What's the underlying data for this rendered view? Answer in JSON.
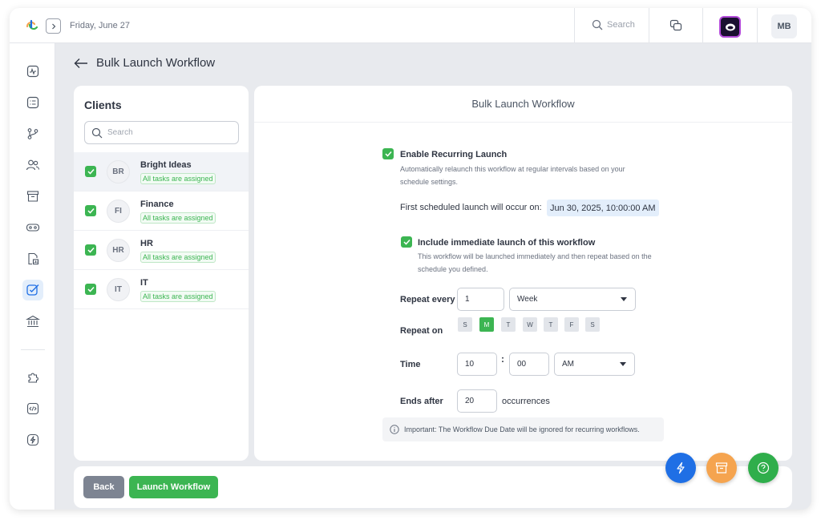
{
  "topbar": {
    "date": "Friday, June 27",
    "search_label": "Search",
    "avatar_initials": "MB"
  },
  "page": {
    "title": "Bulk Launch Workflow"
  },
  "clients": {
    "title": "Clients",
    "search_placeholder": "Search",
    "items": [
      {
        "initials": "BR",
        "name": "Bright Ideas",
        "status": "All tasks are assigned",
        "checked": true
      },
      {
        "initials": "FI",
        "name": "Finance",
        "status": "All tasks are assigned",
        "checked": true
      },
      {
        "initials": "HR",
        "name": "HR",
        "status": "All tasks are assigned",
        "checked": true
      },
      {
        "initials": "IT",
        "name": "IT",
        "status": "All tasks are assigned",
        "checked": true
      }
    ]
  },
  "main": {
    "title": "Bulk Launch Workflow",
    "recurring": {
      "label": "Enable Recurring Launch",
      "desc_line1": "Automatically relaunch this workflow at regular intervals based on your",
      "desc_line2": "schedule settings.",
      "checked": true
    },
    "first_launch": {
      "label": "First scheduled launch will occur on:",
      "value": "Jun 30, 2025, 10:00:00 AM"
    },
    "immediate": {
      "label": "Include immediate launch of this workflow",
      "desc_line1": "This workflow will be launched immediately and then repeat based on the",
      "desc_line2": "schedule you defined.",
      "checked": true
    },
    "repeat_every": {
      "label": "Repeat every",
      "value": "1",
      "unit": "Week"
    },
    "repeat_on": {
      "label": "Repeat on",
      "days": [
        "S",
        "M",
        "T",
        "W",
        "T",
        "F",
        "S"
      ],
      "selected_index": 1
    },
    "time": {
      "label": "Time",
      "hour": "10",
      "separator": ":",
      "minute": "00",
      "period": "AM"
    },
    "ends_after": {
      "label": "Ends after",
      "value": "20",
      "suffix": "occurrences"
    },
    "note": "Important: The Workflow Due Date will be ignored for recurring workflows."
  },
  "footer": {
    "back_label": "Back",
    "launch_label": "Launch Workflow"
  },
  "colors": {
    "accent_green": "#3cb552",
    "fab_blue": "#1f6fe5",
    "fab_orange": "#f5a44f",
    "fab_green": "#2fae4b"
  }
}
